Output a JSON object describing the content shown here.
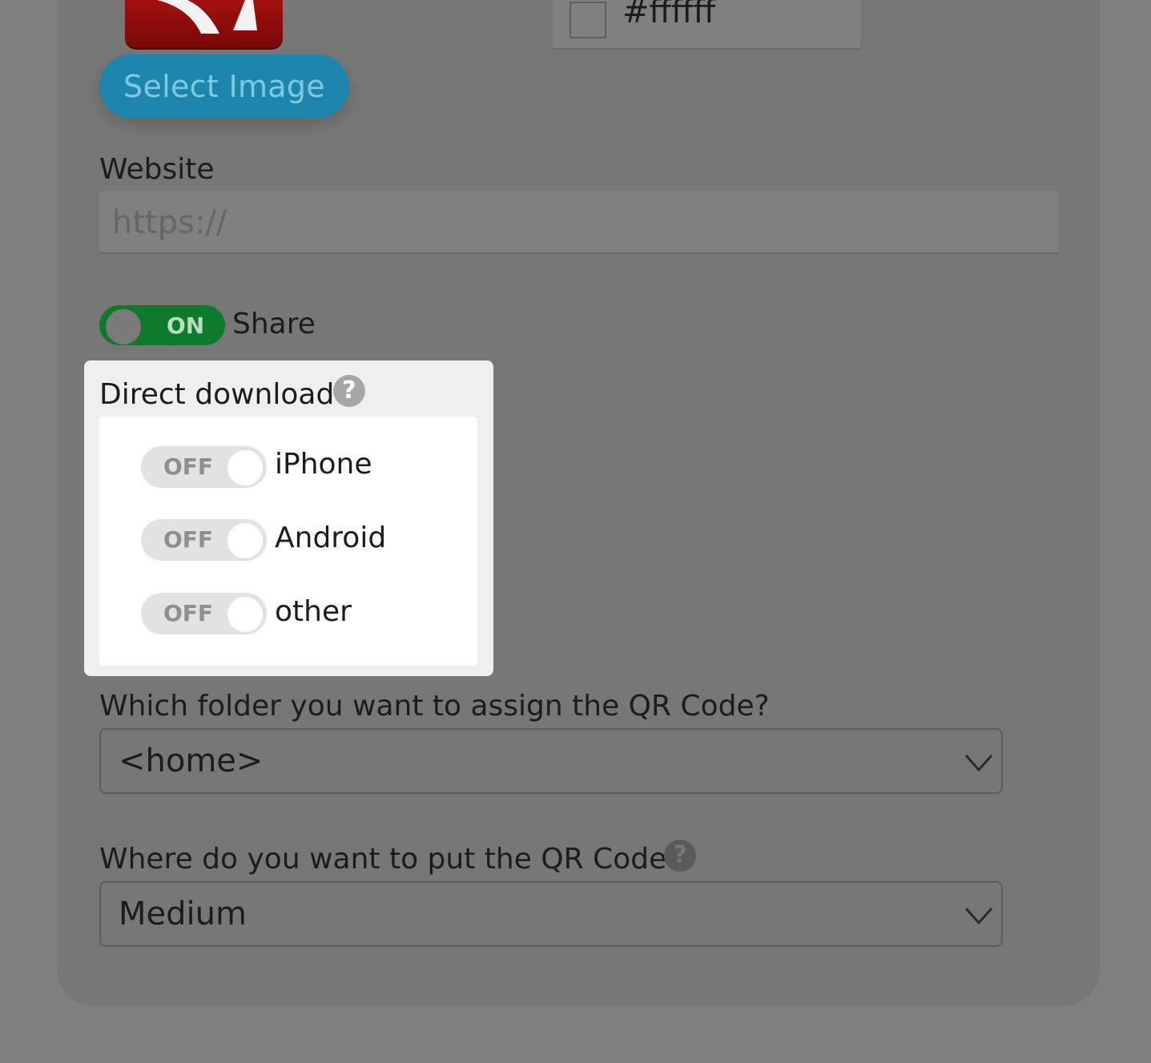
{
  "image_picker": {
    "select_label": "Select Image"
  },
  "color_picker": {
    "value": "#ffffff"
  },
  "website": {
    "label": "Website",
    "placeholder": "https://"
  },
  "share_toggle": {
    "state": "ON",
    "label": "Share"
  },
  "direct_download": {
    "title": "Direct download",
    "help": "?",
    "options": [
      {
        "state": "OFF",
        "label": "iPhone"
      },
      {
        "state": "OFF",
        "label": "Android"
      },
      {
        "state": "OFF",
        "label": "other"
      }
    ]
  },
  "folder": {
    "label": "Which folder you want to assign the QR Code?",
    "selected": "<home>"
  },
  "position": {
    "label": "Where do you want to put the QR Code?",
    "help": "?",
    "selected": "Medium"
  },
  "colors": {
    "button_blue": "#1e86ad",
    "toggle_on_green": "#0e7a2c",
    "icon_red": "#a31010"
  }
}
